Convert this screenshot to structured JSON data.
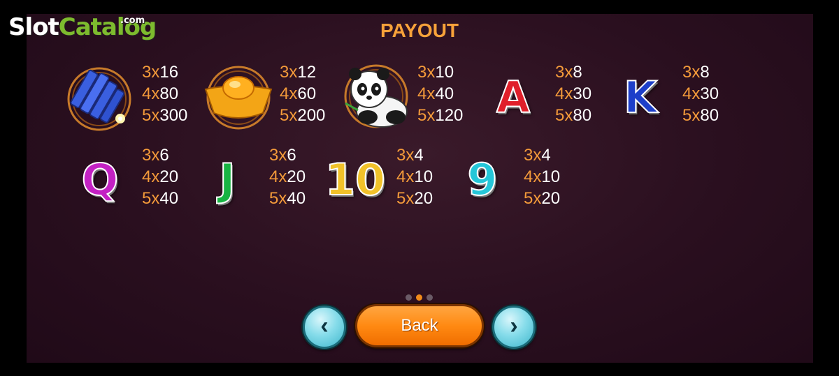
{
  "watermark": {
    "slot": "Slot",
    "catalog": "Catalog",
    "com": ".com"
  },
  "title": "PAYOUT",
  "symbols": [
    {
      "name": "firecrackers",
      "pays": [
        {
          "m": "3x",
          "v": "16"
        },
        {
          "m": "4x",
          "v": "80"
        },
        {
          "m": "5x",
          "v": "300"
        }
      ]
    },
    {
      "name": "gold-ingot",
      "pays": [
        {
          "m": "3x",
          "v": "12"
        },
        {
          "m": "4x",
          "v": "60"
        },
        {
          "m": "5x",
          "v": "200"
        }
      ]
    },
    {
      "name": "panda",
      "pays": [
        {
          "m": "3x",
          "v": "10"
        },
        {
          "m": "4x",
          "v": "40"
        },
        {
          "m": "5x",
          "v": "120"
        }
      ]
    },
    {
      "name": "A",
      "glyph": "A",
      "color": "#e01f2a",
      "pays": [
        {
          "m": "3x",
          "v": "8"
        },
        {
          "m": "4x",
          "v": "30"
        },
        {
          "m": "5x",
          "v": "80"
        }
      ]
    },
    {
      "name": "K",
      "glyph": "K",
      "color": "#1d3fc9",
      "pays": [
        {
          "m": "3x",
          "v": "8"
        },
        {
          "m": "4x",
          "v": "30"
        },
        {
          "m": "5x",
          "v": "80"
        }
      ]
    },
    {
      "name": "Q",
      "glyph": "Q",
      "color": "#c321c3",
      "pays": [
        {
          "m": "3x",
          "v": "6"
        },
        {
          "m": "4x",
          "v": "20"
        },
        {
          "m": "5x",
          "v": "40"
        }
      ]
    },
    {
      "name": "J",
      "glyph": "J",
      "color": "#18b443",
      "pays": [
        {
          "m": "3x",
          "v": "6"
        },
        {
          "m": "4x",
          "v": "20"
        },
        {
          "m": "5x",
          "v": "40"
        }
      ]
    },
    {
      "name": "10",
      "glyph": "10",
      "color": "#f1c22a",
      "pays": [
        {
          "m": "3x",
          "v": "4"
        },
        {
          "m": "4x",
          "v": "10"
        },
        {
          "m": "5x",
          "v": "20"
        }
      ]
    },
    {
      "name": "9",
      "glyph": "9",
      "color": "#25c6d8",
      "pays": [
        {
          "m": "3x",
          "v": "4"
        },
        {
          "m": "4x",
          "v": "10"
        },
        {
          "m": "5x",
          "v": "20"
        }
      ]
    }
  ],
  "pagination": {
    "total": 3,
    "active": 2
  },
  "buttons": {
    "back": "Back",
    "prev_icon": "chevron-left-icon",
    "next_icon": "chevron-right-icon"
  }
}
